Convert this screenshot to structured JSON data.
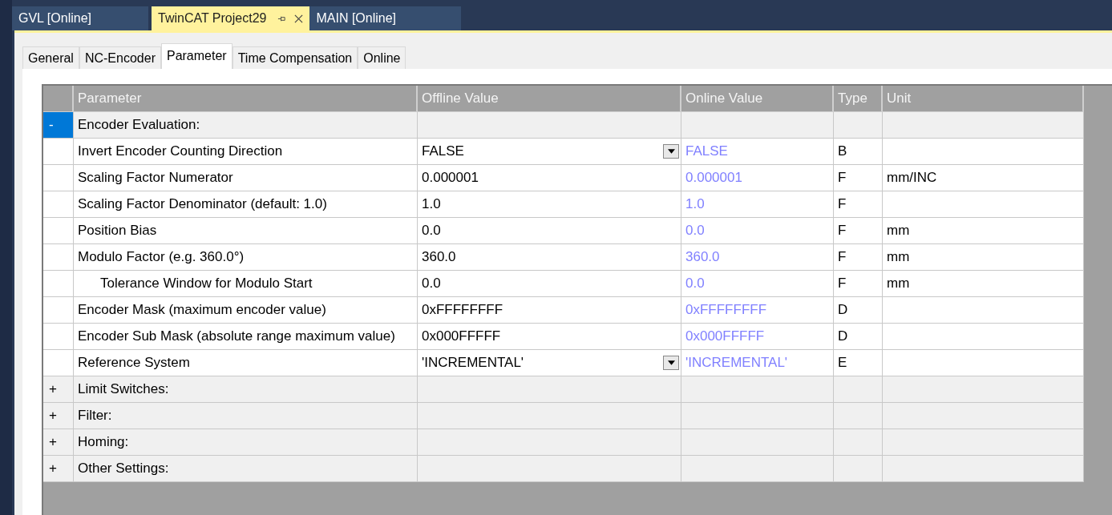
{
  "document_tabs": [
    {
      "label": "GVL [Online]",
      "selected": false
    },
    {
      "label": "TwinCAT Project29",
      "selected": true
    },
    {
      "label": "MAIN [Online]",
      "selected": false
    }
  ],
  "tabs": [
    {
      "label": "General",
      "selected": false
    },
    {
      "label": "NC-Encoder",
      "selected": false
    },
    {
      "label": "Parameter",
      "selected": true
    },
    {
      "label": "Time Compensation",
      "selected": false
    },
    {
      "label": "Online",
      "selected": false
    }
  ],
  "table": {
    "columns": [
      "Parameter",
      "Offline Value",
      "Online Value",
      "Type",
      "Unit"
    ],
    "groups": [
      {
        "toggle": "-",
        "label": "Encoder Evaluation:",
        "selected": true,
        "children": [
          {
            "kind": "dropdown",
            "name": "Invert Encoder Counting Direction",
            "offline": "FALSE",
            "online": "FALSE",
            "type": "B"
          },
          {
            "kind": "value",
            "name": "Scaling Factor Numerator",
            "offline": "0.000001",
            "online": "0.000001",
            "type": "F",
            "unit": "mm/INC"
          },
          {
            "kind": "value",
            "name": "Scaling Factor Denominator (default: 1.0)",
            "offline": "1.0",
            "online": "1.0",
            "type": "F"
          },
          {
            "kind": "value",
            "name": "Position Bias",
            "offline": "0.0",
            "online": "0.0",
            "type": "F",
            "unit": "mm"
          },
          {
            "kind": "value",
            "name": "Modulo Factor (e.g. 360.0°)",
            "offline": "360.0",
            "online": "360.0",
            "type": "F",
            "unit": "mm",
            "children": [
              {
                "kind": "value",
                "name": "Tolerance Window for Modulo Start",
                "offline": "0.0",
                "online": "0.0",
                "type": "F",
                "unit": "mm"
              }
            ]
          },
          {
            "kind": "value",
            "name": "Encoder Mask (maximum encoder value)",
            "offline": "0xFFFFFFFF",
            "online": "0xFFFFFFFF",
            "type": "D"
          },
          {
            "kind": "value",
            "name": "Encoder Sub Mask (absolute range maximum value)",
            "offline": "0x000FFFFF",
            "online": "0x000FFFFF",
            "type": "D"
          },
          {
            "kind": "dropdown",
            "name": "Reference System",
            "offline": "'INCREMENTAL'",
            "online": "'INCREMENTAL'",
            "type": "E"
          }
        ]
      },
      {
        "toggle": "+",
        "label": "Limit Switches:",
        "selected": false
      },
      {
        "toggle": "+",
        "label": "Filter:",
        "selected": false
      },
      {
        "toggle": "+",
        "label": "Homing:",
        "selected": false
      },
      {
        "toggle": "+",
        "label": "Other Settings:",
        "selected": false
      }
    ]
  }
}
